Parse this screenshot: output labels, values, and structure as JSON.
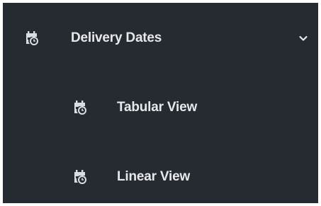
{
  "sidebar": {
    "section": {
      "label": "Delivery Dates",
      "icon": "calendar-clock-icon",
      "toggle_icon": "chevron-down-icon",
      "expanded": true
    },
    "items": [
      {
        "label": "Tabular View",
        "icon": "calendar-clock-icon"
      },
      {
        "label": "Linear View",
        "icon": "calendar-clock-icon"
      }
    ]
  },
  "colors": {
    "background": "#262a31",
    "text": "#e6e8ec",
    "icon": "#d9dce1"
  }
}
